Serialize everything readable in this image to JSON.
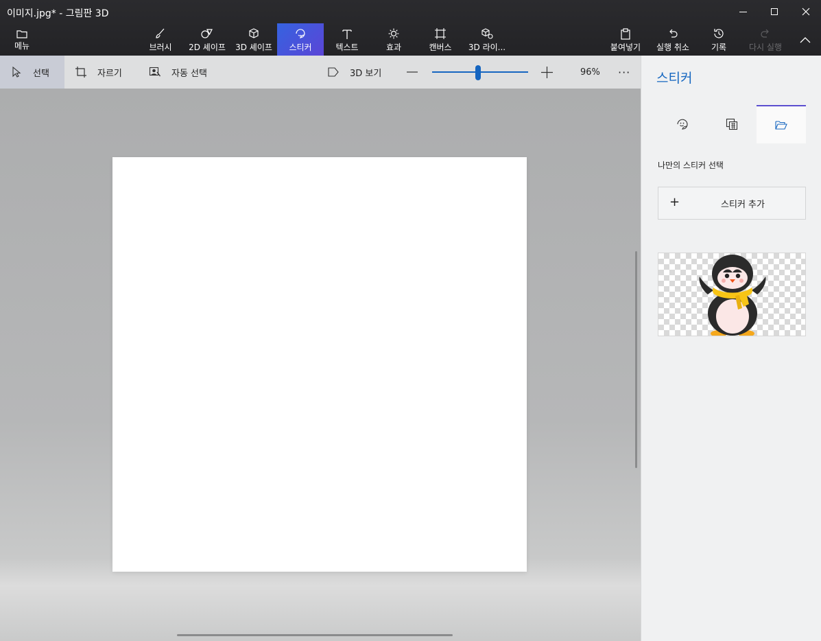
{
  "window": {
    "title": "이미지.jpg* - 그림판 3D"
  },
  "ribbon": {
    "menu_label": "메뉴",
    "items": [
      {
        "label": "브러시",
        "icon": "brush-icon"
      },
      {
        "label": "2D 셰이프",
        "icon": "2d-shapes-icon"
      },
      {
        "label": "3D 셰이프",
        "icon": "3d-shapes-icon"
      },
      {
        "label": "스티커",
        "icon": "sticker-icon",
        "active": true
      },
      {
        "label": "텍스트",
        "icon": "text-icon"
      },
      {
        "label": "효과",
        "icon": "effects-icon"
      },
      {
        "label": "캔버스",
        "icon": "canvas-icon"
      },
      {
        "label": "3D 라이...",
        "icon": "3d-library-icon"
      }
    ],
    "actions": [
      {
        "label": "붙여넣기",
        "icon": "paste-icon"
      },
      {
        "label": "실행 취소",
        "icon": "undo-icon"
      },
      {
        "label": "기록",
        "icon": "history-icon"
      },
      {
        "label": "다시 실행",
        "icon": "redo-icon",
        "disabled": true
      }
    ]
  },
  "toolbar": {
    "select_label": "선택",
    "crop_label": "자르기",
    "magic_select_label": "자동 선택",
    "view3d_label": "3D 보기",
    "zoom_value": "96%",
    "zoom_level": 0.48
  },
  "panel": {
    "title": "스티커",
    "section_label": "나만의 스티커 선택",
    "add_sticker_label": "스티커 추가",
    "tabs": [
      "sticker-smiley-icon",
      "texture-icon",
      "folder-icon"
    ],
    "sticker_thumbnail": "penguin-sticker"
  },
  "colors": {
    "accent": "#1566c0",
    "active_tab": "#4a55d8",
    "ribbon_bg": "#27272a"
  }
}
